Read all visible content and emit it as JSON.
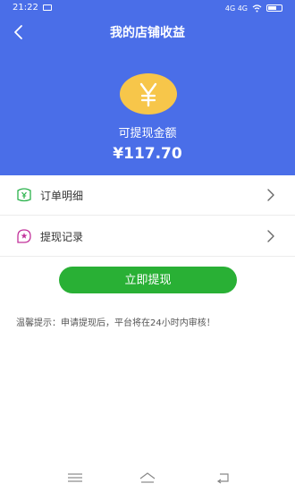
{
  "status_bar": {
    "time": "21:22",
    "signal_text": "4G 4G"
  },
  "header": {
    "title": "我的店铺收益",
    "amount_label": "可提现金额",
    "amount_value": "¥117.70"
  },
  "list": {
    "items": [
      {
        "label": "订单明细",
        "icon": "yen-wallet-icon"
      },
      {
        "label": "提现记录",
        "icon": "record-star-icon"
      }
    ]
  },
  "actions": {
    "withdraw_label": "立即提现"
  },
  "tip": {
    "text": "温馨提示：申请提现后，平台将在24小时内审核！"
  },
  "colors": {
    "header_blue": "#4a6ee8",
    "button_green": "#29b035",
    "coin_gold": "#f7c64a"
  }
}
